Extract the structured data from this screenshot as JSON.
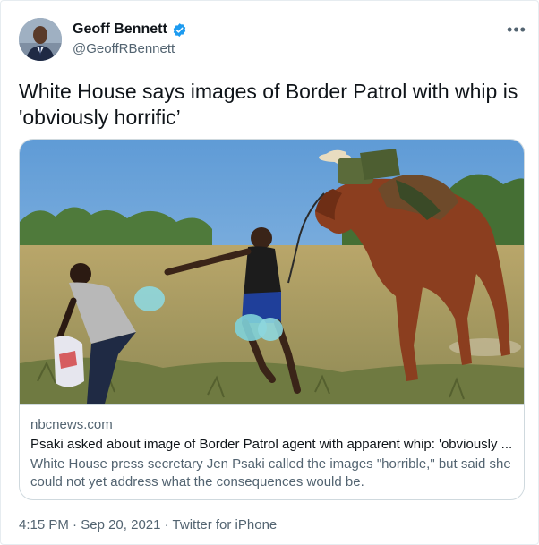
{
  "author": {
    "display_name": "Geoff Bennett",
    "handle": "@GeoffRBennett",
    "verified": true,
    "avatar_icon": "profile-photo"
  },
  "more_label": "•••",
  "tweet": {
    "text": "White House says images of Border Patrol with whip is 'obviously horrific’"
  },
  "card": {
    "domain": "nbcnews.com",
    "title": "Psaki asked about image of Border Patrol agent with apparent whip: 'obviously ...",
    "description": "White House press secretary Jen Psaki called the images \"horrible,\" but said she could not yet address what the consequences would be."
  },
  "footer": {
    "time": "4:15 PM",
    "separator": "·",
    "date": "Sep 20, 2021",
    "source": "Twitter for iPhone"
  },
  "colors": {
    "verified_badge": "#1d9bf0",
    "secondary_text": "#536471",
    "primary_text": "#0f1419",
    "card_border": "#cfd9de"
  }
}
